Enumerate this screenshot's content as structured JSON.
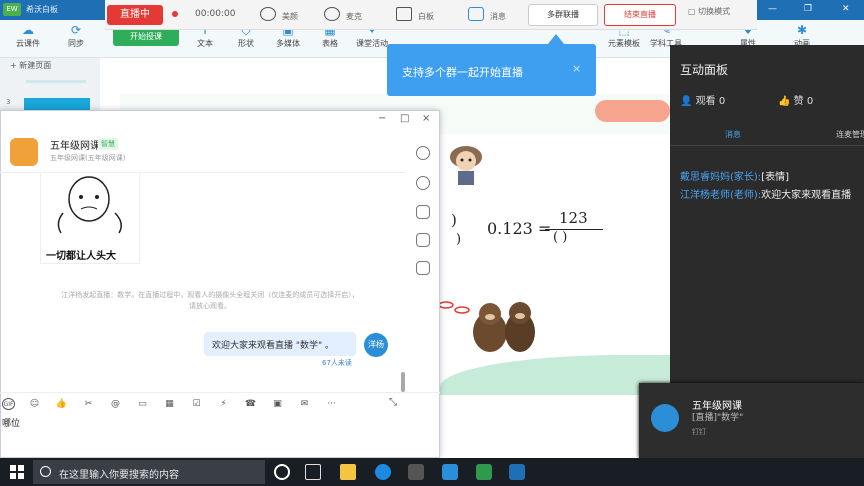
{
  "app": {
    "logo": "EW",
    "title": "希沃白板"
  },
  "livebar": {
    "live_button": "直播中",
    "timer": "00:00:00",
    "beauty": "美颜",
    "mic": "麦克",
    "whiteboard": "白板",
    "message": "消息",
    "multi_group": "多群联播",
    "end_live": "结束直播",
    "switch_mode": "切换模式"
  },
  "toolbar": {
    "cloud": "云课件",
    "sync": "同步",
    "start_class": "开始授课",
    "text": "文本",
    "shape": "形状",
    "media": "多媒体",
    "table": "表格",
    "activity": "课堂活动",
    "element_lib": "元素模板",
    "subject_tools": "学科工具",
    "properties": "属性",
    "animation": "动画"
  },
  "left_panel": {
    "new_page": "+ 新建页面",
    "slide_number": "3"
  },
  "tooltip": {
    "text": "支持多个群一起开始直播",
    "close": "×"
  },
  "canvas": {
    "frac_top": ")",
    "frac_bottom": ")",
    "equation": "0.123 =",
    "numerator": "123",
    "denominator": "(    )"
  },
  "right_panel": {
    "title": "互动面板",
    "viewers": "观看 0",
    "likes": "赞 0",
    "tab_messages": "消息",
    "tab_mic": "连麦管理",
    "messages": [
      {
        "name": "戴思睿妈妈(家长):",
        "text": "[表情]"
      },
      {
        "name": "江洋杨老师(老师):",
        "text": "欢迎大家来观看直播"
      }
    ]
  },
  "chat": {
    "group_name": "五年级网课",
    "badge": "智慧",
    "sub": "五年级网课(五年级网课)",
    "meme_caption": "一切都让人头大",
    "system_msg": "江洋杨发起直播：数学。在直播过程中，观看人的摄像头全程关闭（仅连麦的成员可选择开启），请放心观看。",
    "bubble_text": "欢迎大家来观看直播 \"数学\" 。",
    "bubble_avatar": "洋杨",
    "unread": "67人未读",
    "input_text": "哪位",
    "window": {
      "min": "−",
      "max": "□",
      "close": "×"
    }
  },
  "notification": {
    "title": "五年级网课",
    "body": "[直播]\"数学\"",
    "app": "钉钉"
  },
  "taskbar": {
    "search_placeholder": "在这里输入你要搜索的内容"
  },
  "colors": {
    "accent": "#2a8fd6",
    "live_red": "#e53935",
    "panel_dark": "#2b2b2b",
    "start_green": "#2fae59"
  }
}
